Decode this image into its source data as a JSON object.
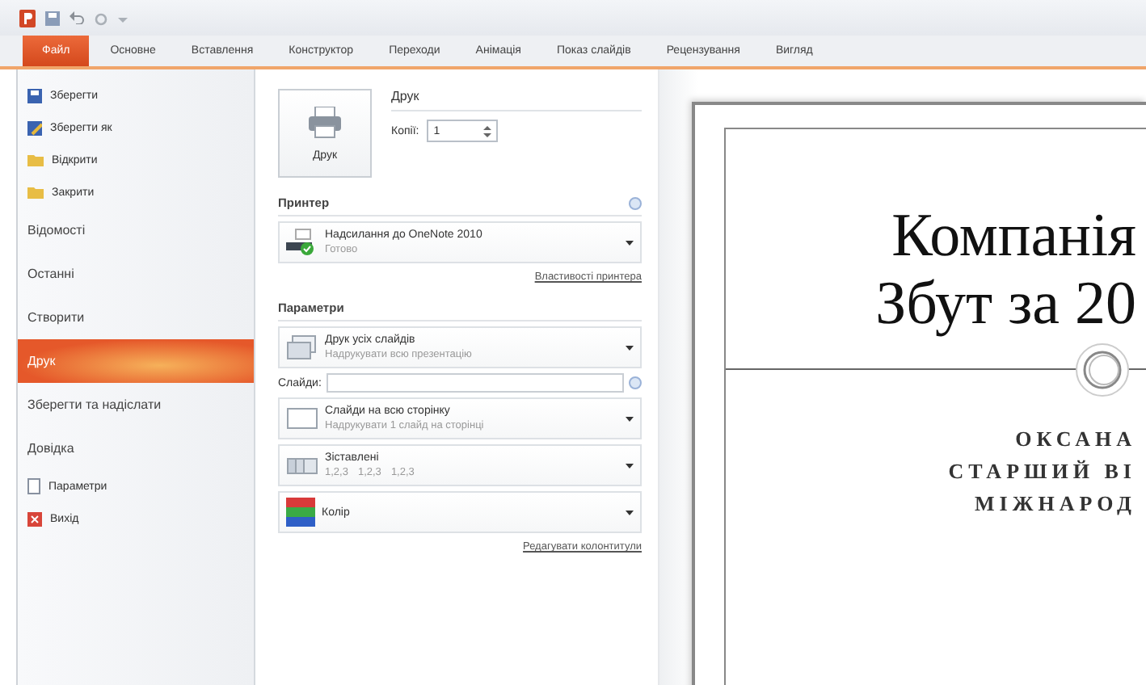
{
  "ribbon_tabs": [
    {
      "label": "Файл",
      "selected": true
    },
    {
      "label": "Основне",
      "selected": false
    },
    {
      "label": "Вставлення",
      "selected": false
    },
    {
      "label": "Конструктор",
      "selected": false
    },
    {
      "label": "Переходи",
      "selected": false
    },
    {
      "label": "Анімація",
      "selected": false
    },
    {
      "label": "Показ слайдів",
      "selected": false
    },
    {
      "label": "Рецензування",
      "selected": false
    },
    {
      "label": "Вигляд",
      "selected": false
    }
  ],
  "sidebar": {
    "items": [
      {
        "kind": "command",
        "label": "Зберегти",
        "selected": false
      },
      {
        "kind": "command",
        "label": "Зберегти як",
        "selected": false
      },
      {
        "kind": "command",
        "label": "Відкрити",
        "selected": false
      },
      {
        "kind": "command",
        "label": "Закрити",
        "selected": false
      },
      {
        "kind": "tab",
        "label": "Відомості",
        "selected": false
      },
      {
        "kind": "tab",
        "label": "Останні",
        "selected": false
      },
      {
        "kind": "tab",
        "label": "Створити",
        "selected": false
      },
      {
        "kind": "tab",
        "label": "Друк",
        "selected": true
      },
      {
        "kind": "tab",
        "label": "Зберегти та надіслати",
        "selected": false
      },
      {
        "kind": "tab",
        "label": "Довідка",
        "selected": false
      },
      {
        "kind": "command",
        "label": "Параметри",
        "selected": false
      },
      {
        "kind": "command",
        "label": "Вихід",
        "selected": false
      }
    ]
  },
  "print": {
    "button_label": "Друк",
    "heading": "Друк",
    "copies_label": "Копії:",
    "copies_value": "1"
  },
  "printer": {
    "heading": "Принтер",
    "name": "Надсилання до OneNote 2010",
    "status": "Готово",
    "properties_link": "Властивості принтера"
  },
  "settings": {
    "heading": "Параметри",
    "options": [
      {
        "kind": "range",
        "title": "Друк усіх слайдів",
        "subtitle": "Надрукувати всю презентацію"
      },
      {
        "kind": "slides-field",
        "label": "Слайди:"
      },
      {
        "kind": "layout",
        "title": "Слайди на всю сторінку",
        "subtitle": "Надрукувати 1 слайд на сторінці"
      },
      {
        "kind": "collate",
        "title": "Зіставлені",
        "sequences": [
          "1,2,3",
          "1,2,3",
          "1,2,3"
        ]
      },
      {
        "kind": "color",
        "title": "Колір"
      }
    ],
    "footer_link": "Редагувати колонтитули"
  },
  "preview": {
    "title_lines": [
      "Компанія",
      "Збут за 20"
    ],
    "subtitle_lines": [
      "ОКСАНА",
      "СТАРШИЙ ВІ",
      "МІЖНАРОД"
    ]
  }
}
